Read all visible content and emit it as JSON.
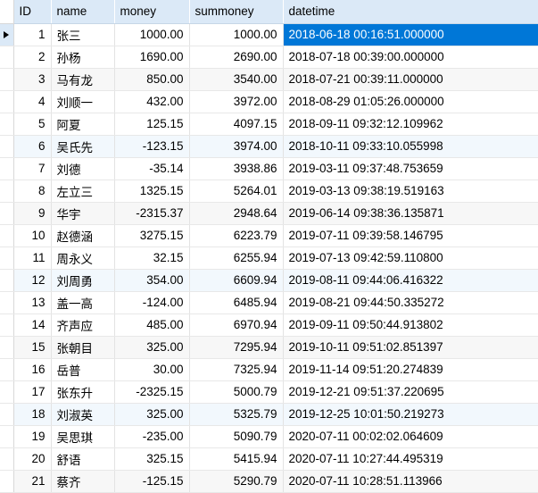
{
  "grid": {
    "columns": [
      {
        "key": "id",
        "label": "ID",
        "align": "right"
      },
      {
        "key": "name",
        "label": "name",
        "align": "left"
      },
      {
        "key": "money",
        "label": "money",
        "align": "right"
      },
      {
        "key": "summoney",
        "label": "summoney",
        "align": "right"
      },
      {
        "key": "datetime",
        "label": "datetime",
        "align": "left"
      }
    ],
    "selected_row_index": 0,
    "selected_cell_column": "datetime",
    "row_indicator_icon": "play-triangle-icon",
    "colors": {
      "header_background": "#dbe9f7",
      "selection_background": "#0077d7",
      "selection_text": "#ffffff",
      "alt_row_background": "#f7f7f7",
      "alt_row_blue_background": "#f2f8fd",
      "grid_line": "#e3e3e3",
      "text": "#000000"
    },
    "rows": [
      {
        "id": "1",
        "name": "张三",
        "money": "1000.00",
        "summoney": "1000.00",
        "datetime": "2018-06-18 00:16:51.000000"
      },
      {
        "id": "2",
        "name": "孙杨",
        "money": "1690.00",
        "summoney": "2690.00",
        "datetime": "2018-07-18 00:39:00.000000"
      },
      {
        "id": "3",
        "name": "马有龙",
        "money": "850.00",
        "summoney": "3540.00",
        "datetime": "2018-07-21 00:39:11.000000"
      },
      {
        "id": "4",
        "name": "刘顺一",
        "money": "432.00",
        "summoney": "3972.00",
        "datetime": "2018-08-29 01:05:26.000000"
      },
      {
        "id": "5",
        "name": "阿夏",
        "money": "125.15",
        "summoney": "4097.15",
        "datetime": "2018-09-11 09:32:12.109962"
      },
      {
        "id": "6",
        "name": "吴氏先",
        "money": "-123.15",
        "summoney": "3974.00",
        "datetime": "2018-10-11 09:33:10.055998"
      },
      {
        "id": "7",
        "name": "刘德",
        "money": "-35.14",
        "summoney": "3938.86",
        "datetime": "2019-03-11 09:37:48.753659"
      },
      {
        "id": "8",
        "name": "左立三",
        "money": "1325.15",
        "summoney": "5264.01",
        "datetime": "2019-03-13 09:38:19.519163"
      },
      {
        "id": "9",
        "name": "华宇",
        "money": "-2315.37",
        "summoney": "2948.64",
        "datetime": "2019-06-14 09:38:36.135871"
      },
      {
        "id": "10",
        "name": "赵德涵",
        "money": "3275.15",
        "summoney": "6223.79",
        "datetime": "2019-07-11 09:39:58.146795"
      },
      {
        "id": "11",
        "name": "周永义",
        "money": "32.15",
        "summoney": "6255.94",
        "datetime": "2019-07-13 09:42:59.110800"
      },
      {
        "id": "12",
        "name": "刘周勇",
        "money": "354.00",
        "summoney": "6609.94",
        "datetime": "2019-08-11 09:44:06.416322"
      },
      {
        "id": "13",
        "name": "盖一高",
        "money": "-124.00",
        "summoney": "6485.94",
        "datetime": "2019-08-21 09:44:50.335272"
      },
      {
        "id": "14",
        "name": "齐声应",
        "money": "485.00",
        "summoney": "6970.94",
        "datetime": "2019-09-11 09:50:44.913802"
      },
      {
        "id": "15",
        "name": "张朝目",
        "money": "325.00",
        "summoney": "7295.94",
        "datetime": "2019-10-11 09:51:02.851397"
      },
      {
        "id": "16",
        "name": "岳普",
        "money": "30.00",
        "summoney": "7325.94",
        "datetime": "2019-11-14 09:51:20.274839"
      },
      {
        "id": "17",
        "name": "张东升",
        "money": "-2325.15",
        "summoney": "5000.79",
        "datetime": "2019-12-21 09:51:37.220695"
      },
      {
        "id": "18",
        "name": "刘淑英",
        "money": "325.00",
        "summoney": "5325.79",
        "datetime": "2019-12-25 10:01:50.219273"
      },
      {
        "id": "19",
        "name": "吴思琪",
        "money": "-235.00",
        "summoney": "5090.79",
        "datetime": "2020-07-11 00:02:02.064609"
      },
      {
        "id": "20",
        "name": "舒语",
        "money": "325.15",
        "summoney": "5415.94",
        "datetime": "2020-07-11 10:27:44.495319"
      },
      {
        "id": "21",
        "name": "蔡齐",
        "money": "-125.15",
        "summoney": "5290.79",
        "datetime": "2020-07-11 10:28:51.113966"
      }
    ]
  }
}
